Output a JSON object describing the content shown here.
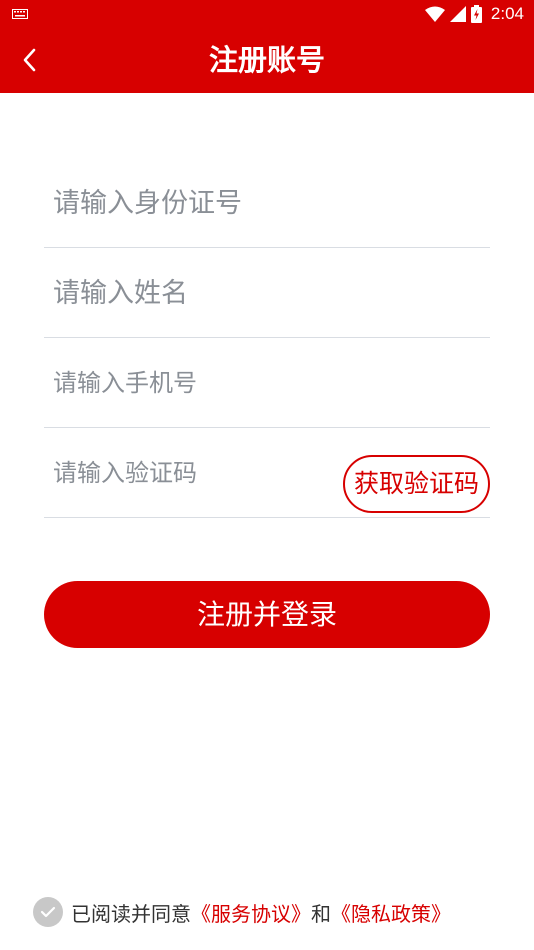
{
  "status_bar": {
    "time": "2:04",
    "icons": [
      "keyboard-icon",
      "wifi-icon",
      "signal-icon",
      "battery-charging-icon"
    ]
  },
  "header": {
    "title": "注册账号",
    "back_icon": "chevron-left-icon"
  },
  "form": {
    "id_placeholder": "请输入身份证号",
    "name_placeholder": "请输入姓名",
    "phone_placeholder": "请输入手机号",
    "code_placeholder": "请输入验证码",
    "get_code_label": "获取验证码"
  },
  "submit_label": "注册并登录",
  "agreement": {
    "prefix": "已阅读并同意",
    "service_link": "《服务协议》",
    "and": "和",
    "privacy_link": "《隐私政策》",
    "checked": false
  },
  "colors": {
    "brand": "#d70000",
    "placeholder": "#8a8f96",
    "divider": "#d9dde3",
    "checkbox_gray": "#c8c8c8"
  }
}
